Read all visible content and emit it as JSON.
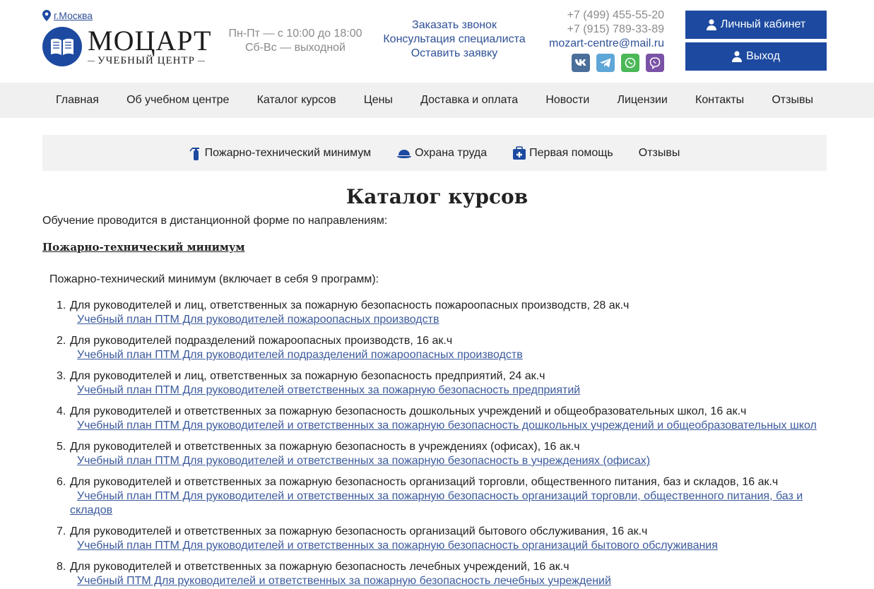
{
  "header": {
    "city": "г.Москва",
    "logo_title": "МОЦАРТ",
    "logo_subtitle": "УЧЕБНЫЙ ЦЕНТР",
    "hours_weekdays": "Пн-Пт — с 10:00 до 18:00",
    "hours_weekend": "Сб-Вс — выходной",
    "links": [
      "Заказать звонок",
      "Консультация специалиста",
      "Оставить заявку"
    ],
    "phone1": "+7 (499) 455-55-20",
    "phone2": "+7 (915) 789-33-89",
    "email": "mozart-centre@mail.ru",
    "cabinet_button": "Личный кабинет",
    "exit_button": "Выход"
  },
  "mainnav": [
    "Главная",
    "Об учебном центре",
    "Каталог курсов",
    "Цены",
    "Доставка и оплата",
    "Новости",
    "Лицензии",
    "Контакты",
    "Отзывы"
  ],
  "subnav": [
    "Пожарно-технический минимум",
    "Охрана труда",
    "Первая помощь",
    "Отзывы"
  ],
  "content": {
    "title": "Каталог курсов",
    "intro": "Обучение проводится в дистанционной форме по направлениям:",
    "section": "Пожарно-технический минимум",
    "sub_intro": "Пожарно-технический минимум (включает в себя 9 программ):",
    "courses": [
      {
        "num": "1.",
        "title": "Для руководителей и лиц, ответственных за пожарную безопасность пожароопасных производств, 28 ак.ч",
        "plan": "Учебный план ПТМ Для руководителей пожароопасных производств"
      },
      {
        "num": "2.",
        "title": "Для руководителей подразделений пожароопасных производств, 16 ак.ч",
        "plan": "Учебный план ПТМ Для руководителей подразделений пожароопасных производств"
      },
      {
        "num": "3.",
        "title": "Для руководителей и лиц, ответственных за пожарную безопасность предприятий, 24 ак.ч",
        "plan": "Учебный план ПТМ Для руководителей ответственных за пожарную безопасность предприятий"
      },
      {
        "num": "4.",
        "title": "Для руководителей и ответственных за пожарную безопасность дошкольных учреждений и общеобразовательных школ, 16 ак.ч",
        "plan": "Учебный план ПТМ Для руководителей и ответственных за пожарную безопасность дошкольных учреждений и общеобразовательных школ"
      },
      {
        "num": "5.",
        "title": "Для руководителей и ответственных за пожарную безопасность в учреждениях (офисах), 16 ак.ч",
        "plan": "Учебный план ПТМ Для руководителей и ответственных за пожарную безопасность в учреждениях (офисах)"
      },
      {
        "num": "6.",
        "title": "Для руководителей и ответственных за пожарную безопасность организаций торговли, общественного питания, баз и складов, 16 ак.ч",
        "plan": "Учебный план ПТМ Для руководителей и ответственных за пожарную безопасность организаций торговли, общественного питания, баз и складов"
      },
      {
        "num": "7.",
        "title": "Для руководителей и ответственных за пожарную безопасность организаций бытового обслуживания, 16 ак.ч",
        "plan": "Учебный план ПТМ Для руководителей и ответственных за пожарную безопасность организаций бытового обслуживания"
      },
      {
        "num": "8.",
        "title": "Для руководителей и ответственных за пожарную безопасность лечебных учреждений, 16 ак.ч",
        "plan": "Учебный ПТМ Для руководителей и ответственных за пожарную безопасность лечебных учреждений"
      }
    ]
  },
  "colors": {
    "brand_blue": "#1d4aa0",
    "link": "#2f5198",
    "nav_bg": "#f0f0f0"
  }
}
